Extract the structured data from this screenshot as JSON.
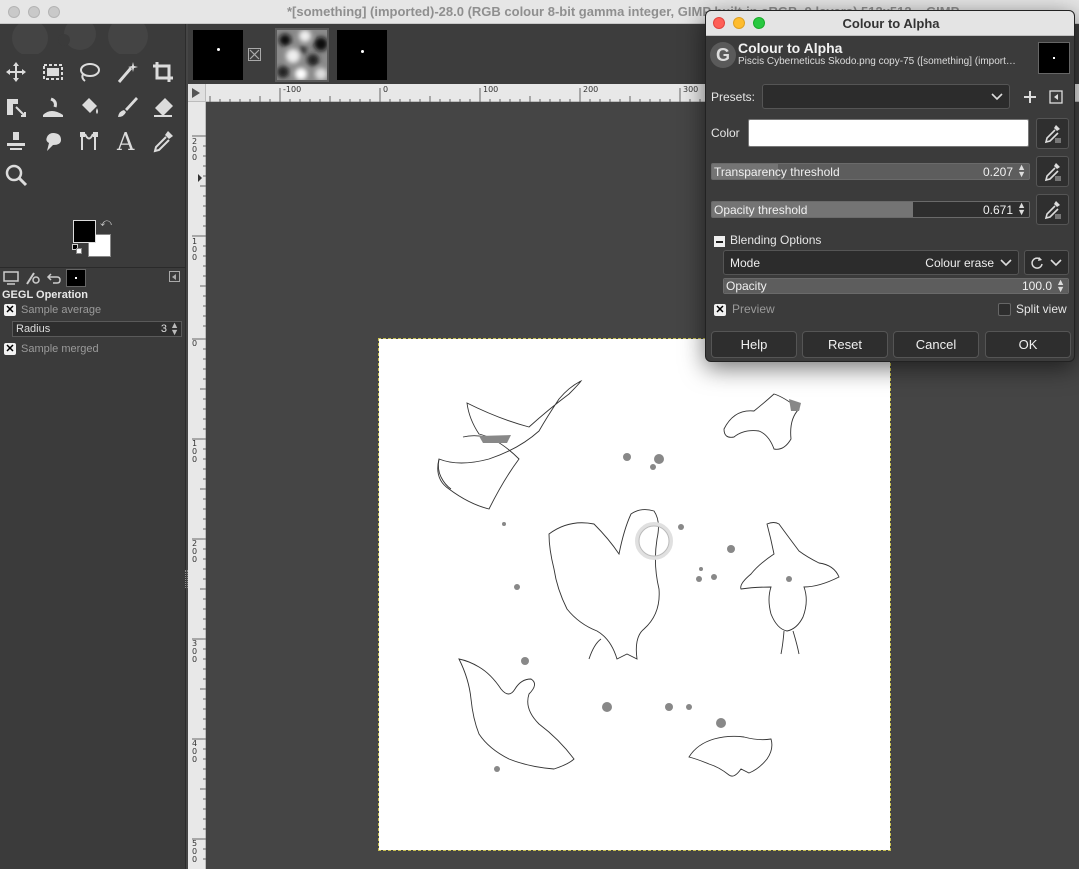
{
  "window": {
    "title": "*[something] (imported)-28.0 (RGB colour 8-bit gamma integer, GIMP built-in sRGB, 9 layers) 512x512 – GIMP"
  },
  "toolbox": {
    "tools": [
      "move-tool",
      "rect-select-tool",
      "free-select-tool",
      "fuzzy-select-tool",
      "crop-tool",
      "transform-tool",
      "warp-tool",
      "bucket-fill-tool",
      "paintbrush-tool",
      "eraser-tool",
      "clone-tool",
      "smudge-tool",
      "paths-tool",
      "text-tool",
      "color-picker-tool",
      "zoom-tool"
    ],
    "colors": {
      "foreground": "#000000",
      "background": "#ffffff"
    },
    "tool_options": {
      "title": "GEGL Operation",
      "sample_average_label": "Sample average",
      "sample_average_checked": true,
      "radius_label": "Radius",
      "radius_value": "3",
      "sample_merged_label": "Sample merged",
      "sample_merged_checked": true
    }
  },
  "image_tabs": [
    {
      "name": "dot-image",
      "active": false
    },
    {
      "name": "blur-image",
      "active": true
    },
    {
      "name": "dot-image-2",
      "active": false
    }
  ],
  "rulers": {
    "horizontal_labels": [
      "-100",
      "0",
      "100",
      "200",
      "300"
    ],
    "vertical_labels": [
      "200",
      "100",
      "0",
      "100",
      "200",
      "300",
      "400",
      "500"
    ]
  },
  "dialog": {
    "window_title": "Colour to Alpha",
    "header_title": "Colour to Alpha",
    "header_subtitle": "Piscis Cyberneticus Skodo.png copy-75 ([something] (import…",
    "presets_label": "Presets:",
    "presets_value": "",
    "color_label": "Color",
    "color_value": "#ffffff",
    "transparency_threshold": {
      "label": "Transparency threshold",
      "value": "0.207",
      "fraction": 0.207
    },
    "opacity_threshold": {
      "label": "Opacity threshold",
      "value": "0.671",
      "fraction": 0.671
    },
    "blending_options_label": "Blending Options",
    "mode_label": "Mode",
    "mode_value": "Colour erase",
    "opacity": {
      "label": "Opacity",
      "value": "100.0",
      "fraction": 1.0
    },
    "preview_label": "Preview",
    "preview_checked": true,
    "split_view_label": "Split view",
    "split_view_checked": false,
    "buttons": {
      "help": "Help",
      "reset": "Reset",
      "cancel": "Cancel",
      "ok": "OK"
    }
  }
}
